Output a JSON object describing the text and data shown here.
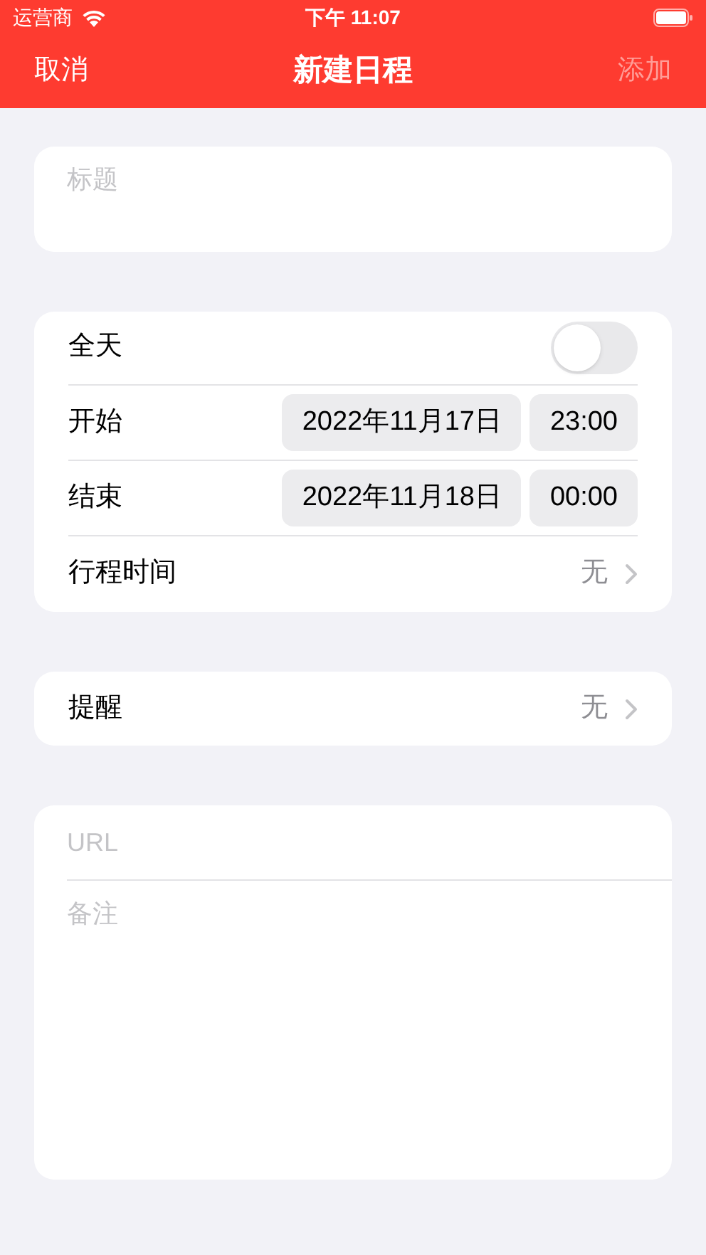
{
  "status_bar": {
    "carrier": "运营商",
    "time": "下午 11:07"
  },
  "nav": {
    "cancel": "取消",
    "title": "新建日程",
    "add": "添加",
    "add_disabled": true
  },
  "title_field": {
    "placeholder": "标题"
  },
  "schedule": {
    "all_day": {
      "label": "全天",
      "on": false
    },
    "start": {
      "label": "开始",
      "date": "2022年11月17日",
      "time": "23:00"
    },
    "end": {
      "label": "结束",
      "date": "2022年11月18日",
      "time": "00:00"
    },
    "travel": {
      "label": "行程时间",
      "value": "无"
    }
  },
  "alert": {
    "label": "提醒",
    "value": "无"
  },
  "notes": {
    "url_placeholder": "URL",
    "notes_placeholder": "备注"
  }
}
